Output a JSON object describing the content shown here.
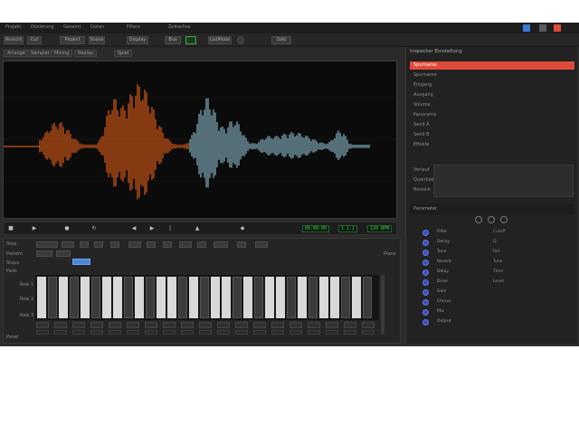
{
  "window": {
    "menu": [
      "Projekt",
      "Dosierung",
      "Gesamt",
      "Daten",
      "Filters",
      "Zeitachse"
    ],
    "colors": {
      "background": "#2b2b2b",
      "accent_orange": "#ff6a1a",
      "accent_blue": "#9fd3e6",
      "accent_green": "#3fd24a",
      "accent_red": "#e04a3a"
    }
  },
  "toolbar": {
    "items": [
      "Ansicht",
      "Cut",
      "Project",
      "Scene",
      "Display",
      "Bus",
      "ListMode",
      "Solo"
    ]
  },
  "tabs": [
    "Arrange",
    "Sampler",
    "Mixing",
    "Replay",
    "Spiel"
  ],
  "transport": {
    "timecode_1": "00:00:00",
    "timecode_2": "1.1.1",
    "timecode_3": "120 BPM",
    "buttons": [
      "stop",
      "play",
      "record",
      "loop",
      "rewind",
      "forward"
    ]
  },
  "editor": {
    "header": "Step",
    "side_labels": [
      "Pattern",
      "Steps",
      "Pads",
      "Row 1",
      "Row 2",
      "Row 3"
    ],
    "footer": "Panel",
    "right_label": "Piano"
  },
  "right_panel": {
    "title": "Inspector Einstellung",
    "rows": [
      "Spurname",
      "Spurname",
      "Eingang",
      "Ausgang",
      "Volume",
      "Panorama",
      "Send A",
      "Send B",
      "Effekte",
      "Effekte",
      "Effekte"
    ],
    "section2_rows": [
      "Verlauf",
      "Quantize",
      "Bereich"
    ],
    "section3_title": "Parameter",
    "controls": [
      "Filter",
      "Decay",
      "Tone",
      "Reverb",
      "Delay",
      "Drive",
      "Gain",
      "Chorus",
      "Mix",
      "Output"
    ],
    "values": [
      "Cutoff",
      "Q",
      "Rel",
      "Tune",
      "Time",
      "Level"
    ]
  }
}
